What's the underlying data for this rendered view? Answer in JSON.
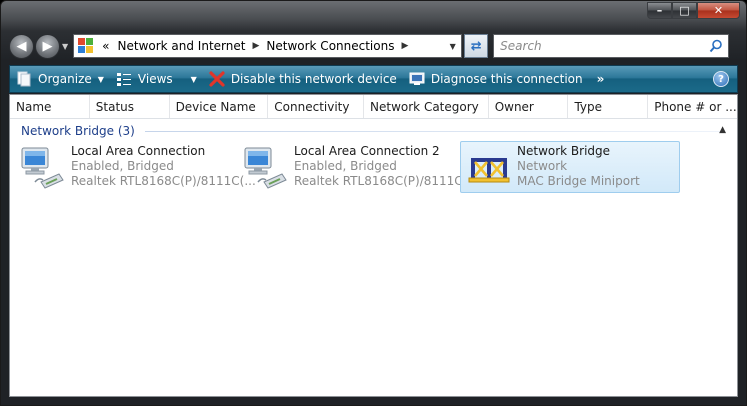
{
  "window": {
    "caption": {
      "minimize": "–",
      "maximize": "□",
      "close": "✕"
    }
  },
  "nav": {
    "back_icon": "back-arrow-icon",
    "forward_icon": "forward-arrow-icon",
    "address": {
      "overflow": "«",
      "crumbs": [
        "Network and Internet",
        "Network Connections"
      ]
    },
    "search_placeholder": "Search"
  },
  "commandbar": {
    "organize": "Organize",
    "views": "Views",
    "disable": "Disable this network device",
    "diagnose": "Diagnose this connection",
    "more": "»",
    "help": "?"
  },
  "columns": [
    "Name",
    "Status",
    "Device Name",
    "Connectivity",
    "Network Category",
    "Owner",
    "Type",
    "Phone # or ..."
  ],
  "group": {
    "label": "Network Bridge (3)"
  },
  "items": [
    {
      "name": "Local Area Connection",
      "status": "Enabled, Bridged",
      "device": "Realtek RTL8168C(P)/8111C(...",
      "icon": "network-adapter-icon"
    },
    {
      "name": "Local Area Connection 2",
      "status": "Enabled, Bridged",
      "device": "Realtek RTL8168C(P)/8111C(...",
      "icon": "network-adapter-icon"
    },
    {
      "name": "Network Bridge",
      "status": "Network",
      "device": "MAC Bridge Miniport",
      "icon": "network-bridge-icon",
      "selected": true
    }
  ],
  "colors": {
    "commandbar": "#1b6a89",
    "selection": "#d2e9f9",
    "group_text": "#1e3f8a"
  }
}
